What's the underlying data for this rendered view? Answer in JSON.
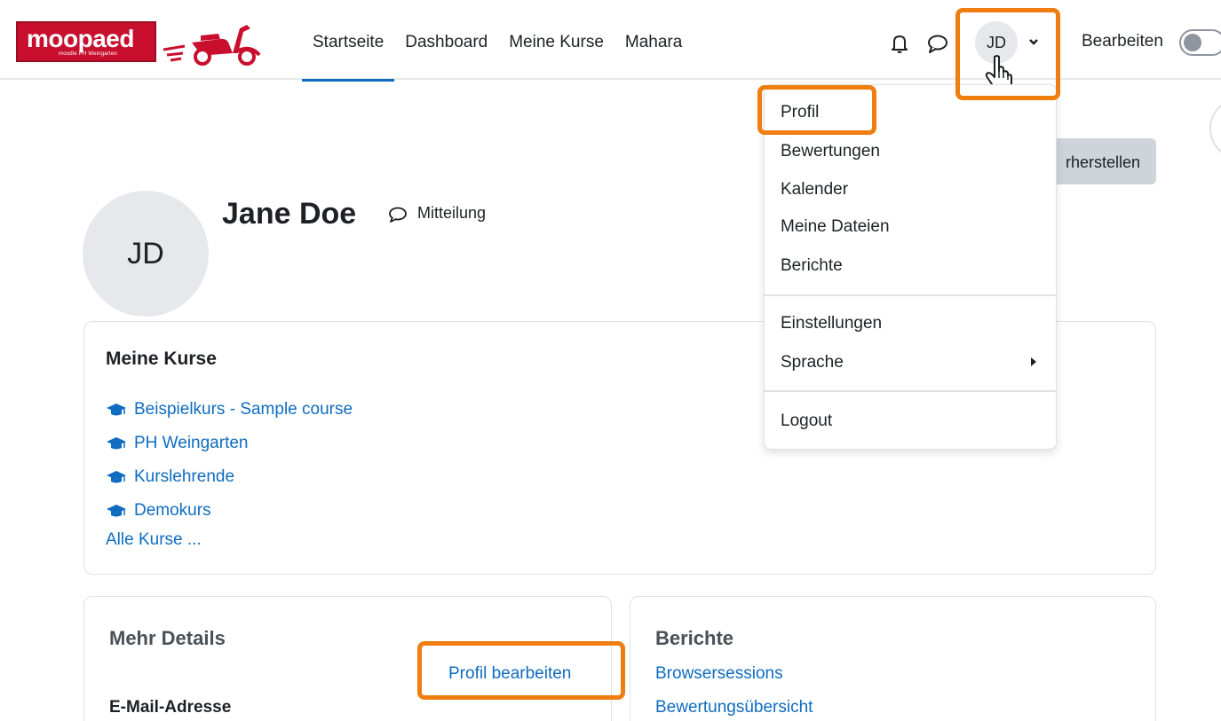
{
  "brand": {
    "logo_text": "moopaed",
    "logo_subtext": "moodle PH Weingarten"
  },
  "nav": {
    "links": [
      "Startseite",
      "Dashboard",
      "Meine Kurse",
      "Mahara"
    ],
    "active_index": 0
  },
  "user_menu": {
    "initials": "JD",
    "items": [
      "Profil",
      "Bewertungen",
      "Kalender",
      "Meine Dateien",
      "Berichte",
      "Einstellungen",
      "Sprache",
      "Logout"
    ]
  },
  "edit_mode": {
    "label": "Bearbeiten",
    "on": false
  },
  "reset_button": {
    "label_visible": "rherstellen"
  },
  "profile": {
    "initials": "JD",
    "name": "Jane Doe",
    "message_label": "Mitteilung"
  },
  "courses_card": {
    "title": "Meine Kurse",
    "courses": [
      "Beispielkurs - Sample course",
      "PH Weingarten",
      "Kurslehrende",
      "Demokurs"
    ],
    "all_courses": "Alle Kurse ..."
  },
  "details_card": {
    "title": "Mehr Details",
    "edit_profile": "Profil bearbeiten",
    "email_label": "E-Mail-Adresse"
  },
  "reports_card": {
    "title": "Berichte",
    "links": [
      "Browsersessions",
      "Bewertungsübersicht"
    ]
  },
  "colors": {
    "brand_red": "#c8102e",
    "link_blue": "#0f6cbf",
    "highlight_orange": "#f07d0f"
  },
  "icons": [
    "bell-icon",
    "chat-icon",
    "chevron-down-icon",
    "hand-cursor-icon",
    "graduation-cap-icon",
    "caret-right-icon",
    "scooter-icon"
  ]
}
